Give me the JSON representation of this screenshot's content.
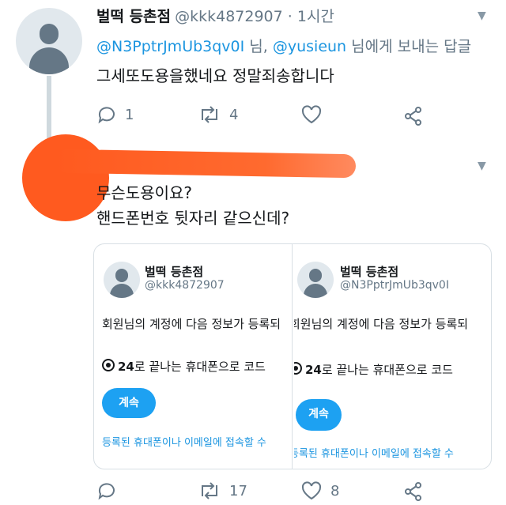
{
  "tweet1": {
    "name": "벌떡 등촌점",
    "handle_time": "@kkk4872907 · 1시간",
    "reply_mention1": "@N3PptrJmUb3qv0I",
    "reply_sep": " 님, ",
    "reply_mention2": "@yusieun",
    "reply_suffix": " 님에게 보내는 답글",
    "text": "그세또도용을했네요 정말죄송합니다",
    "reply_count": "1",
    "retweet_count": "4"
  },
  "tweet2": {
    "text_line1": "무슨도용이요?",
    "text_line2": "핸드폰번호 뒷자리 같으신데?",
    "retweet_count": "17",
    "like_count": "8"
  },
  "cards": [
    {
      "name": "벌떡 등촌점",
      "handle": "@kkk4872907",
      "line1": "회원님의 계정에 다음 정보가 등록되",
      "line2_bold": "24",
      "line2_rest": "로 끝나는 휴대폰으로 코드",
      "button": "계속",
      "link": "등록된 휴대폰이나 이메일에 접속할 수"
    },
    {
      "name": "벌떡 등촌점",
      "handle": "@N3PptrJmUb3qv0I",
      "line1": "회원님의 계정에 다음 정보가 등록되",
      "line2_bold": "24",
      "line2_rest": "로 끝나는 휴대폰으로 코드",
      "button": "계속",
      "link": "등록된 휴대폰이나 이메일에 접속할 수"
    }
  ],
  "icons": {
    "chevron": "chevron-down-icon",
    "reply": "reply-icon",
    "retweet": "retweet-icon",
    "like": "heart-icon",
    "share": "share-icon"
  },
  "colors": {
    "link": "#1b95e0",
    "button": "#1da1f2",
    "redaction": "#ff5a1f"
  }
}
